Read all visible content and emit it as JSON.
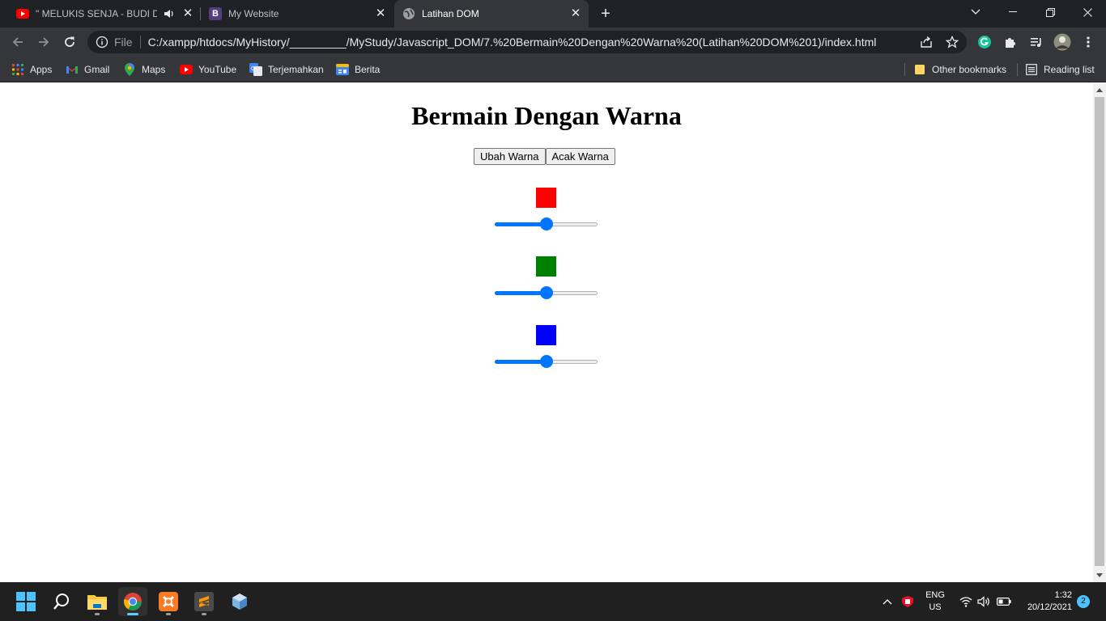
{
  "browser": {
    "tabs": [
      {
        "title": "\" MELUKIS SENJA - BUDI DO",
        "favicon": "youtube-icon",
        "audio": true,
        "active": false
      },
      {
        "title": "My Website",
        "favicon": "bootstrap-icon",
        "active": false
      },
      {
        "title": "Latihan DOM",
        "favicon": "globe-icon",
        "active": true
      }
    ],
    "address_bar": {
      "scheme_label": "File",
      "url": "C:/xampp/htdocs/MyHistory/_________/MyStudy/Javascript_DOM/7.%20Bermain%20Dengan%20Warna%20(Latihan%20DOM%201)/index.html"
    },
    "bookmarks": [
      {
        "label": "Apps",
        "icon": "apps-grid-icon"
      },
      {
        "label": "Gmail",
        "icon": "gmail-icon"
      },
      {
        "label": "Maps",
        "icon": "maps-icon"
      },
      {
        "label": "YouTube",
        "icon": "youtube-icon"
      },
      {
        "label": "Terjemahkan",
        "icon": "translate-icon"
      },
      {
        "label": "Berita",
        "icon": "news-icon"
      }
    ],
    "other_bookmarks": "Other bookmarks",
    "reading_list": "Reading list"
  },
  "page": {
    "title": "Bermain Dengan Warna",
    "buttons": {
      "change_color": "Ubah Warna",
      "random_color": "Acak Warna"
    },
    "swatches": [
      {
        "name": "red",
        "color": "#ff0000",
        "slider_fraction": 0.5
      },
      {
        "name": "green",
        "color": "#008000",
        "slider_fraction": 0.5
      },
      {
        "name": "blue",
        "color": "#0000ff",
        "slider_fraction": 0.5
      }
    ]
  },
  "taskbar": {
    "language": "ENG",
    "region": "US",
    "time": "1:32",
    "date": "20/12/2021",
    "notification_count": "2"
  },
  "colors": {
    "slider_accent": "#0075ff",
    "chrome_dark": "#202124",
    "chrome_toolbar": "#35363a"
  }
}
